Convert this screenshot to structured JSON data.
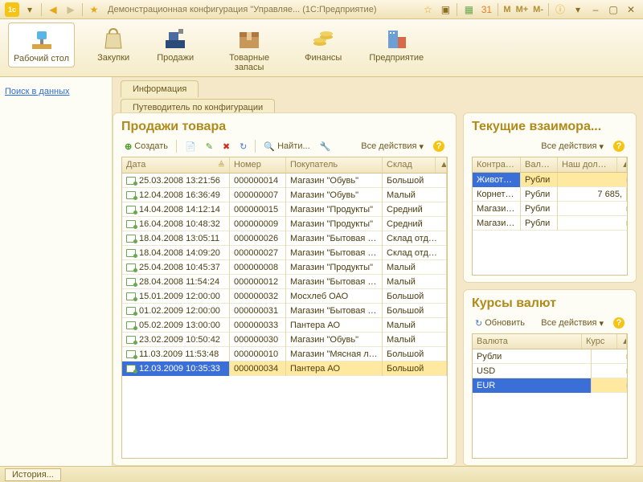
{
  "titlebar": {
    "title": "Демонстрационная конфигурация \"Управляе...   (1С:Предприятие)",
    "mem": [
      "M",
      "M+",
      "M-"
    ]
  },
  "sections": [
    {
      "label": "Рабочий стол",
      "active": true
    },
    {
      "label": "Закупки"
    },
    {
      "label": "Продажи"
    },
    {
      "label": "Товарные запасы"
    },
    {
      "label": "Финансы"
    },
    {
      "label": "Предприятие"
    }
  ],
  "left": {
    "search": "Поиск в данных"
  },
  "tabs": [
    "Информация",
    "Путеводитель по конфигурации"
  ],
  "sales": {
    "title": "Продажи товара",
    "tb": {
      "create": "Создать",
      "find": "Найти...",
      "actions": "Все действия"
    },
    "cols": [
      "Дата",
      "Номер",
      "Покупатель",
      "Склад"
    ],
    "rows": [
      [
        "25.03.2008 13:21:56",
        "000000014",
        "Магазин \"Обувь\"",
        "Большой"
      ],
      [
        "12.04.2008 16:36:49",
        "000000007",
        "Магазин \"Обувь\"",
        "Малый"
      ],
      [
        "14.04.2008 14:12:14",
        "000000015",
        "Магазин \"Продукты\"",
        "Средний"
      ],
      [
        "16.04.2008 10:48:32",
        "000000009",
        "Магазин \"Продукты\"",
        "Средний"
      ],
      [
        "18.04.2008 13:05:11",
        "000000026",
        "Магазин \"Бытовая т…",
        "Склад отд…"
      ],
      [
        "18.04.2008 14:09:20",
        "000000027",
        "Магазин \"Бытовая т…",
        "Склад отд…"
      ],
      [
        "25.04.2008 10:45:37",
        "000000008",
        "Магазин \"Продукты\"",
        "Малый"
      ],
      [
        "28.04.2008 11:54:24",
        "000000012",
        "Магазин \"Бытовая т…",
        "Малый"
      ],
      [
        "15.01.2009 12:00:00",
        "000000032",
        "Мосхлеб ОАО",
        "Большой"
      ],
      [
        "01.02.2009 12:00:00",
        "000000031",
        "Магазин \"Бытовая т…",
        "Большой"
      ],
      [
        "05.02.2009 13:00:00",
        "000000033",
        "Пантера АО",
        "Малый"
      ],
      [
        "23.02.2009 10:50:42",
        "000000030",
        "Магазин \"Обувь\"",
        "Малый"
      ],
      [
        "11.03.2009 11:53:48",
        "000000010",
        "Магазин \"Мясная ла…",
        "Большой"
      ],
      [
        "12.03.2009 10:35:33",
        "000000034",
        "Пантера АО",
        "Большой"
      ]
    ],
    "selected": 13
  },
  "debts": {
    "title": "Текущие взаимора...",
    "actions": "Все действия",
    "cols": [
      "Контраг…",
      "Вал…",
      "Наш дол…"
    ],
    "rows": [
      [
        "Животн…",
        "Рубли",
        ""
      ],
      [
        "Корнет …",
        "Рубли",
        "7 685,"
      ],
      [
        "Магази…",
        "Рубли",
        ""
      ],
      [
        "Магази…",
        "Рубли",
        ""
      ]
    ],
    "selected": 0
  },
  "rates": {
    "title": "Курсы валют",
    "refresh": "Обновить",
    "actions": "Все действия",
    "cols": [
      "Валюта",
      "Курс"
    ],
    "rows": [
      [
        "Рубли",
        ""
      ],
      [
        "USD",
        ""
      ],
      [
        "EUR",
        ""
      ]
    ],
    "selected": 2
  },
  "status": {
    "history": "История..."
  }
}
